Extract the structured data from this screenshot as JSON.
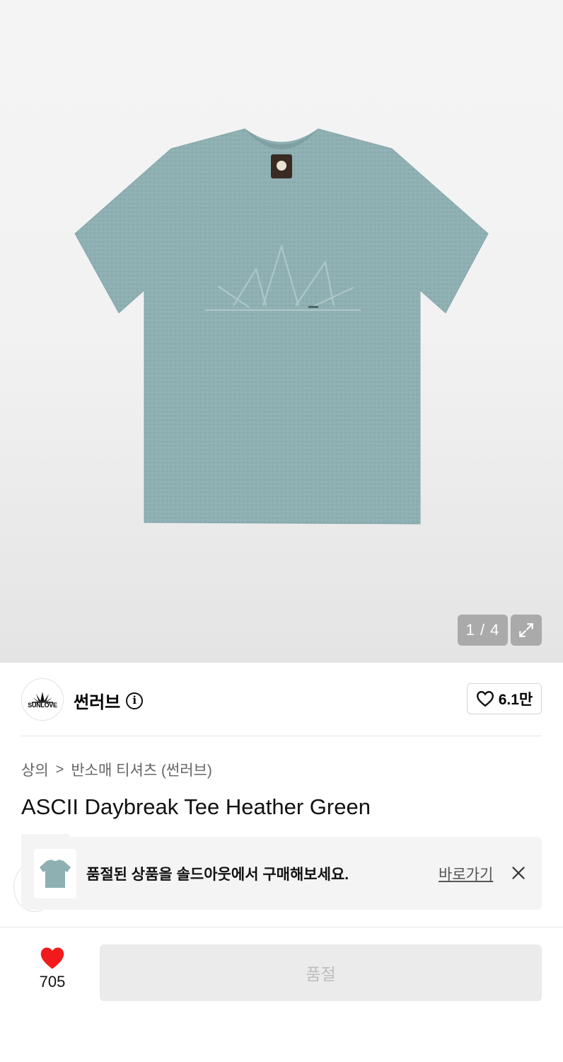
{
  "gallery": {
    "page_indicator": "1 / 4",
    "current_page": 1,
    "total_pages": 4
  },
  "brand": {
    "logo_text": "SUNLOVE",
    "name": "썬러브",
    "info_icon_glyph": "i",
    "like_count": "6.1만"
  },
  "breadcrumb": {
    "level1": "상의",
    "separator": ">",
    "level2": "반소매 티셔츠 (썬러브)"
  },
  "product": {
    "title": "ASCII Daybreak Tee Heather Green",
    "color": "#8fb0b3"
  },
  "soldout_banner": {
    "message": "품절된 상품을 솔드아웃에서 구매해보세요.",
    "link_label": "바로가기"
  },
  "bottom_bar": {
    "like_count": "705",
    "buy_button_label": "품절",
    "heart_color": "#f21b1b"
  },
  "icons": {
    "expand": "expand-icon",
    "heart_outline": "heart-outline-icon",
    "heart_filled": "heart-filled-icon",
    "close": "close-icon",
    "info": "info-icon"
  }
}
